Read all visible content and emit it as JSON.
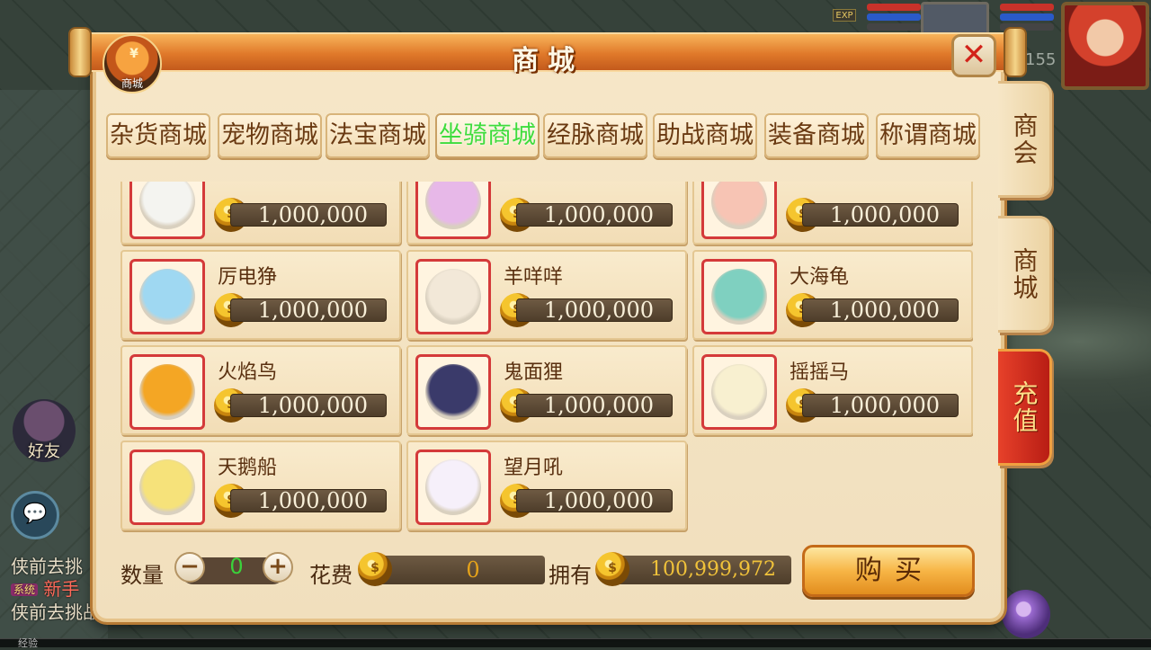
{
  "hud": {
    "exp_tag": "EXP",
    "level_hint": "155",
    "friend_label": "好友",
    "chat_lines": [
      {
        "text": "侠前去挑"
      },
      {
        "tag": "系统",
        "text": "新手"
      },
      {
        "text": "侠前去挑战"
      }
    ],
    "exp_bar_label": "经验"
  },
  "dialog": {
    "title": "商城",
    "badge_label": "商城",
    "badge_symbol": "¥",
    "close_symbol": "✕"
  },
  "category_tabs": [
    "杂货商城",
    "宠物商城",
    "法宝商城",
    "坐骑商城",
    "经脉商城",
    "助战商城",
    "装备商城",
    "称谓商城"
  ],
  "active_tab_index": 3,
  "side_tabs": [
    {
      "label": "商会"
    },
    {
      "label": "商城"
    },
    {
      "label": "充值"
    }
  ],
  "currency_icon": "gold-coin-icon",
  "items": [
    {
      "name": "",
      "price": "1,000,000",
      "color": "#f4f4f0"
    },
    {
      "name": "",
      "price": "1,000,000",
      "color": "#e7b8e8"
    },
    {
      "name": "",
      "price": "1,000,000",
      "color": "#f7c4b4"
    },
    {
      "name": "厉电狰",
      "price": "1,000,000",
      "color": "#9fd8f2"
    },
    {
      "name": "羊咩咩",
      "price": "1,000,000",
      "color": "#f2e8d8"
    },
    {
      "name": "大海龟",
      "price": "1,000,000",
      "color": "#7fd0c0"
    },
    {
      "name": "火焰鸟",
      "price": "1,000,000",
      "color": "#f4a624"
    },
    {
      "name": "鬼面狸",
      "price": "1,000,000",
      "color": "#3a3a6a"
    },
    {
      "name": "摇摇马",
      "price": "1,000,000",
      "color": "#f8f0d0"
    },
    {
      "name": "天鹅船",
      "price": "1,000,000",
      "color": "#f6e27a"
    },
    {
      "name": "望月吼",
      "price": "1,000,000",
      "color": "#f6f0fa"
    }
  ],
  "purchase": {
    "qty_label": "数量",
    "qty_value": "0",
    "minus": "−",
    "plus": "+",
    "cost_label": "花费",
    "cost_value": "0",
    "own_label": "拥有",
    "own_value": "100,999,972",
    "buy_label": "购买"
  },
  "colors": {
    "active_tab_text": "#3fdc3c",
    "price_bar": "#5a4634",
    "icon_border": "#d43a3a",
    "recharge_tab": "#c8261a"
  }
}
